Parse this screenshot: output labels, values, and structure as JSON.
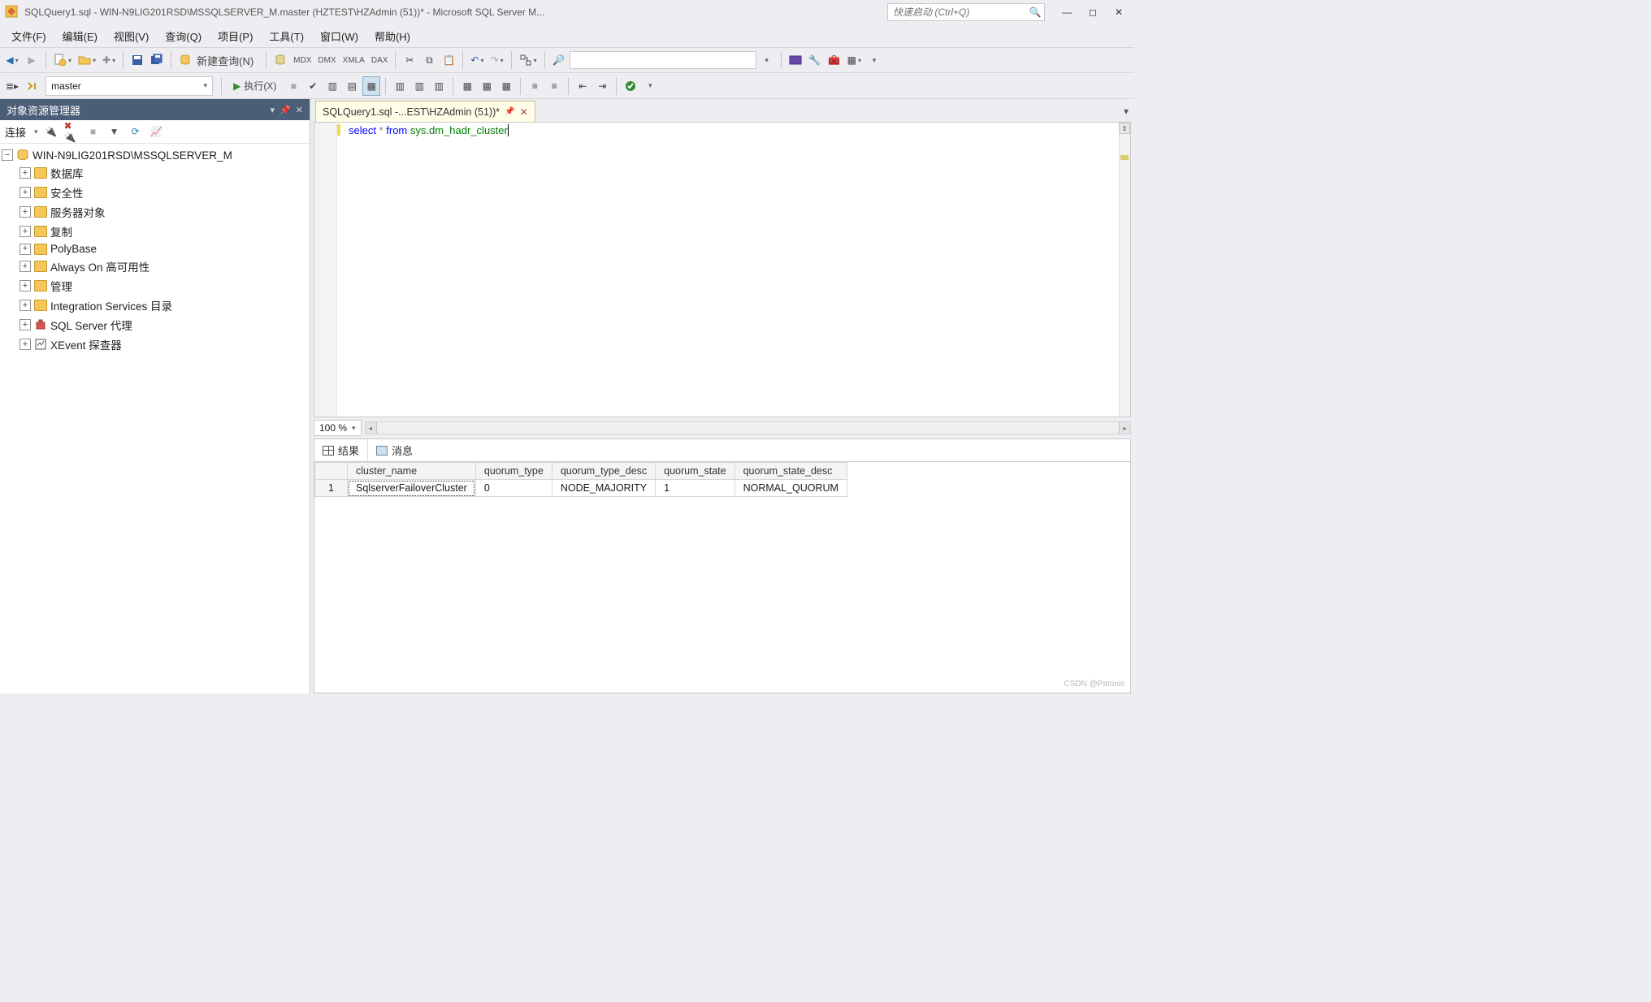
{
  "titlebar": {
    "title": "SQLQuery1.sql - WIN-N9LIG201RSD\\MSSQLSERVER_M.master (HZTEST\\HZAdmin (51))* - Microsoft SQL Server M...",
    "quicklaunch_placeholder": "快速启动 (Ctrl+Q)"
  },
  "menu": {
    "file": "文件(F)",
    "edit": "编辑(E)",
    "view": "视图(V)",
    "query": "查询(Q)",
    "project": "项目(P)",
    "tools": "工具(T)",
    "window": "窗口(W)",
    "help": "帮助(H)"
  },
  "toolbar1": {
    "new_query": "新建查询(N)"
  },
  "toolbar2": {
    "database": "master",
    "execute": "执行(X)"
  },
  "sidebar": {
    "title": "对象资源管理器",
    "connect_label": "连接",
    "server": "WIN-N9LIG201RSD\\MSSQLSERVER_M",
    "nodes": {
      "databases": "数据库",
      "security": "安全性",
      "server_objects": "服务器对象",
      "replication": "复制",
      "polybase": "PolyBase",
      "alwayson": "Always On 高可用性",
      "management": "管理",
      "integration": "Integration Services 目录",
      "agent": "SQL Server 代理",
      "xevent": "XEvent 探查器"
    }
  },
  "tab": {
    "label": "SQLQuery1.sql -...EST\\HZAdmin (51))*"
  },
  "editor": {
    "code_kw1": "select",
    "code_op": " * ",
    "code_kw2": "from",
    "code_sp": " ",
    "code_sys": "sys",
    "code_dot": ".",
    "code_obj": "dm_hadr_cluster",
    "zoom": "100 %"
  },
  "results": {
    "tab_results": "结果",
    "tab_messages": "消息",
    "columns": {
      "c1": "cluster_name",
      "c2": "quorum_type",
      "c3": "quorum_type_desc",
      "c4": "quorum_state",
      "c5": "quorum_state_desc"
    },
    "row1": {
      "num": "1",
      "c1": "SqlserverFailoverCluster",
      "c2": "0",
      "c3": "NODE_MAJORITY",
      "c4": "1",
      "c5": "NORMAL_QUORUM"
    }
  },
  "watermark": "CSDN @Patonis"
}
